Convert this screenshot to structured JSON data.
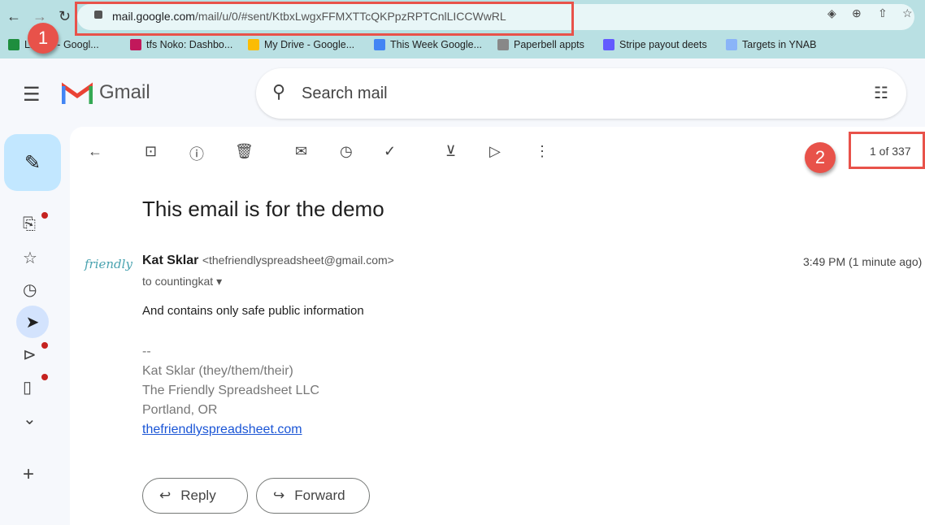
{
  "browser": {
    "url_host": "mail.google.com",
    "url_path": "/mail/u/0/#sent/KtbxLwgxFFMXTTcQKPpzRPTCnlLICCWwRL",
    "bookmarks": [
      {
        "label": "Lindex - Googl...",
        "color": "#1e8e3e"
      },
      {
        "label": "tfs Noko: Dashbo...",
        "color": "#c2185b"
      },
      {
        "label": "My Drive - Google...",
        "color": "#fbbc04"
      },
      {
        "label": "This Week Google...",
        "color": "#4285f4"
      },
      {
        "label": "Paperbell appts",
        "color": "#888888"
      },
      {
        "label": "Stripe payout deets",
        "color": "#635bff"
      },
      {
        "label": "Targets in YNAB",
        "color": "#8ab4f8"
      }
    ]
  },
  "annotations": {
    "badge1": "1",
    "badge2": "2",
    "accent": "#e8524a"
  },
  "gmail": {
    "logo": "Gmail",
    "search_placeholder": "Search mail",
    "pagination": "1 of 337"
  },
  "email": {
    "subject": "This email is for the demo",
    "sender_name": "Kat Sklar",
    "sender_email": "<thefriendlyspreadsheet@gmail.com>",
    "to": "to countingkat",
    "time": "3:49 PM (1 minute ago)",
    "body": "And contains only safe public information",
    "sig_dash": "--",
    "sig_name": "Kat Sklar (they/them/their)",
    "sig_company": "The Friendly Spreadsheet LLC",
    "sig_location": "Portland, OR",
    "sig_link": "thefriendlyspreadsheet.com",
    "avatar_text": "friendly"
  },
  "actions": {
    "reply": "Reply",
    "forward": "Forward"
  }
}
